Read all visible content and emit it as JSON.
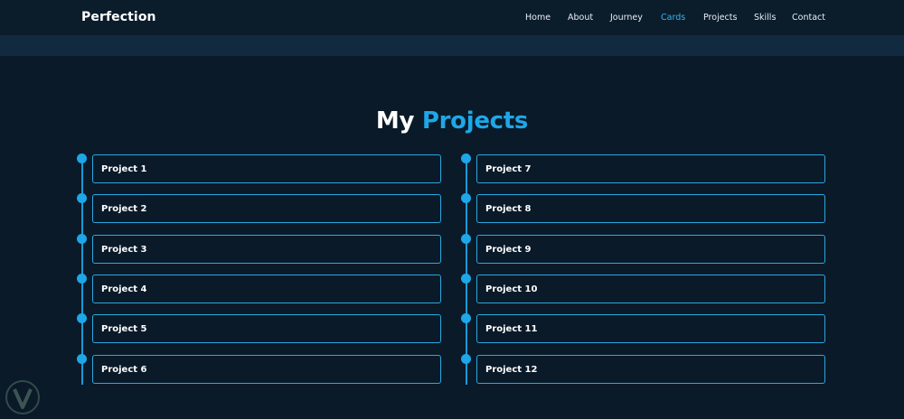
{
  "nav": {
    "brand": "Perfection",
    "links": [
      {
        "label": "Home",
        "active": false
      },
      {
        "label": "About",
        "active": false
      },
      {
        "label": "Journey",
        "active": false
      },
      {
        "label": "Cards",
        "active": true
      },
      {
        "label": "Projects",
        "active": false
      },
      {
        "label": "Skills",
        "active": false
      },
      {
        "label": "Contact",
        "active": false
      }
    ]
  },
  "section": {
    "title_word1": "My",
    "title_word2": "Projects"
  },
  "projects_left": [
    {
      "label": "Project 1"
    },
    {
      "label": "Project 2"
    },
    {
      "label": "Project 3"
    },
    {
      "label": "Project 4"
    },
    {
      "label": "Project 5"
    },
    {
      "label": "Project 6"
    }
  ],
  "projects_right": [
    {
      "label": "Project 7"
    },
    {
      "label": "Project 8"
    },
    {
      "label": "Project 9"
    },
    {
      "label": "Project 10"
    },
    {
      "label": "Project 11"
    },
    {
      "label": "Project 12"
    }
  ],
  "colors": {
    "background": "#0a1a29",
    "accent": "#1ea7e8",
    "active_link": "#38b6f0",
    "text": "#ffffff"
  },
  "icons": {
    "watermark": "shield-logo-icon"
  }
}
